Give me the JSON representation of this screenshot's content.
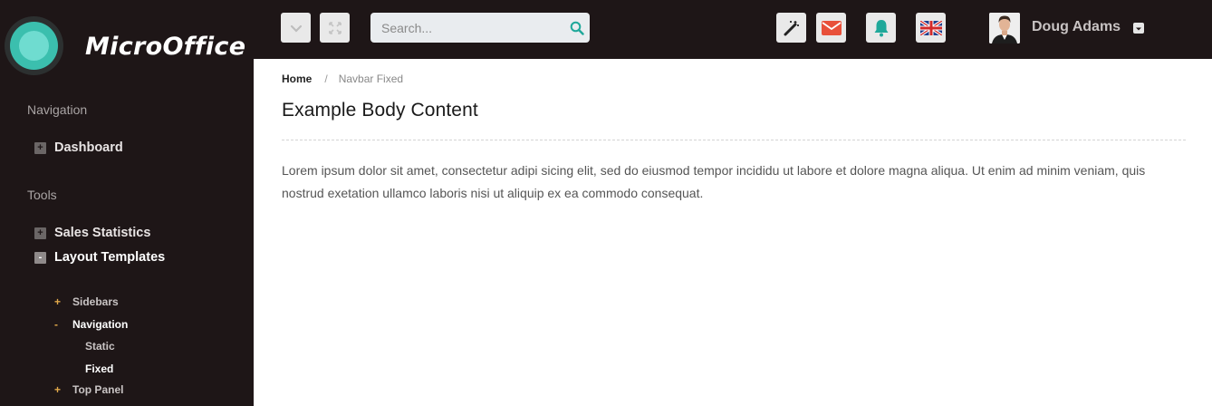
{
  "brand": {
    "name": "MicroOffice"
  },
  "sidebar": {
    "sections": {
      "navigation": "Navigation",
      "tools": "Tools"
    },
    "items": {
      "dashboard": {
        "label": "Dashboard",
        "expander": "+"
      },
      "sales_statistics": {
        "label": "Sales Statistics",
        "expander": "+"
      },
      "layout_templates": {
        "label": "Layout Templates",
        "expander": "-"
      }
    },
    "sub_items": {
      "sidebars": {
        "label": "Sidebars",
        "mark": "+"
      },
      "navigation": {
        "label": "Navigation",
        "mark": "-"
      },
      "static": {
        "label": "Static"
      },
      "fixed": {
        "label": "Fixed"
      },
      "top_panel": {
        "label": "Top Panel",
        "mark": "+"
      }
    }
  },
  "topbar": {
    "search": {
      "placeholder": "Search..."
    },
    "user": {
      "name": "Doug Adams"
    },
    "icons": [
      "chevron-down-icon",
      "expand-icon",
      "magic-wand-icon",
      "envelope-icon",
      "bell-icon",
      "uk-flag-icon"
    ],
    "colors": {
      "envelope_bg": "#e8503a",
      "bell": "#1fa89a",
      "search_icon": "#1fa89a"
    }
  },
  "breadcrumb": {
    "home": "Home",
    "separator": "/",
    "current": "Navbar Fixed"
  },
  "main": {
    "title": "Example Body Content",
    "paragraph": "Lorem ipsum dolor sit amet, consectetur adipi sicing elit, sed do eiusmod tempor incididu ut labore et dolore magna aliqua. Ut enim ad minim veniam, quis nostrud exetation ullamco laboris nisi ut aliquip ex ea commodo consequat."
  }
}
